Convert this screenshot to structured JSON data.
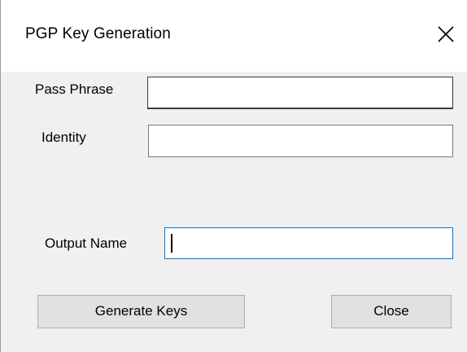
{
  "window": {
    "title": "PGP Key Generation",
    "close_icon": "close-icon"
  },
  "form": {
    "pass_phrase": {
      "label": "Pass Phrase",
      "value": ""
    },
    "identity": {
      "label": "Identity",
      "value": ""
    },
    "output_name": {
      "label": "Output Name",
      "value": ""
    }
  },
  "buttons": {
    "generate": "Generate Keys",
    "close": "Close"
  },
  "colors": {
    "titlebar": "#ffffff",
    "body": "#f0f0f0",
    "button": "#e1e1e1",
    "focus_border": "#0078d7"
  }
}
